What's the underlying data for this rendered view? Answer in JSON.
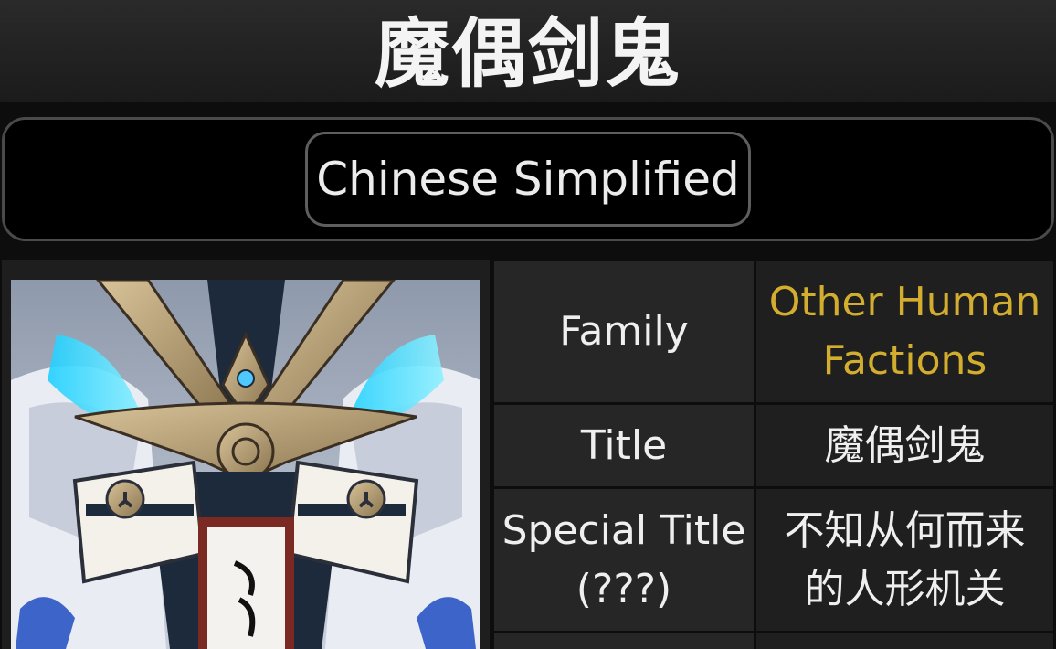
{
  "header": {
    "title": "魔偶剑鬼"
  },
  "language": {
    "selected": "Chinese Simplified"
  },
  "colors": {
    "link": "#d3ad2d",
    "background": "#0d0d0d",
    "cell": "#262626"
  },
  "info": {
    "family_label": "Family",
    "family_value_line1": "Other Human",
    "family_value_line2": "Factions",
    "title_label": "Title",
    "title_value": "魔偶剑鬼",
    "special_label_line1": "Special Title",
    "special_label_line2": "(???)",
    "special_value_line1": "不知从何而来",
    "special_value_line2": "的人形机关"
  }
}
